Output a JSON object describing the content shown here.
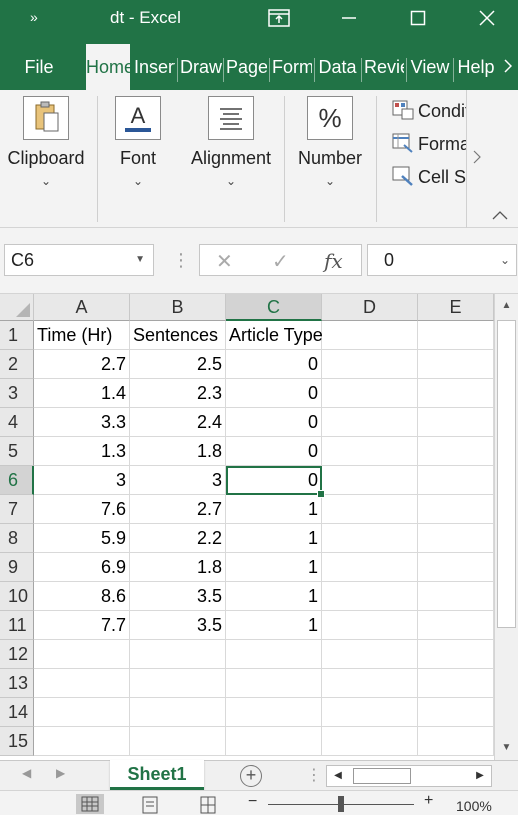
{
  "window": {
    "qat_label": "»",
    "title": "dt  -  Excel"
  },
  "tabs": [
    {
      "label": "File"
    },
    {
      "label": "Home"
    },
    {
      "label": "Insert"
    },
    {
      "label": "Draw"
    },
    {
      "label": "Page"
    },
    {
      "label": "Form"
    },
    {
      "label": "Data"
    },
    {
      "label": "Review"
    },
    {
      "label": "View"
    },
    {
      "label": "Help"
    }
  ],
  "ribbon": {
    "groups": [
      {
        "label": "Clipboard"
      },
      {
        "label": "Font"
      },
      {
        "label": "Alignment"
      },
      {
        "label": "Number"
      }
    ],
    "number_icon_glyph": "%",
    "styles": [
      {
        "label": "Conditional"
      },
      {
        "label": "Format"
      },
      {
        "label": "Cell Styles"
      }
    ]
  },
  "formula_bar": {
    "name_box": "C6",
    "fx": "fx",
    "value": "0"
  },
  "grid": {
    "columns": [
      "A",
      "B",
      "C",
      "D",
      "E"
    ],
    "selected_column": "C",
    "selected_row": 6,
    "row_numbers": [
      1,
      2,
      3,
      4,
      5,
      6,
      7,
      8,
      9,
      10,
      11,
      12,
      13,
      14,
      15
    ],
    "header_row": [
      "Time (Hr)",
      "Sentences",
      "Article Type"
    ],
    "rows": [
      [
        "2.7",
        "2.5",
        "0"
      ],
      [
        "1.4",
        "2.3",
        "0"
      ],
      [
        "3.3",
        "2.4",
        "0"
      ],
      [
        "1.3",
        "1.8",
        "0"
      ],
      [
        "3",
        "3",
        "0"
      ],
      [
        "7.6",
        "2.7",
        "1"
      ],
      [
        "5.9",
        "2.2",
        "1"
      ],
      [
        "6.9",
        "1.8",
        "1"
      ],
      [
        "8.6",
        "3.5",
        "1"
      ],
      [
        "7.7",
        "3.5",
        "1"
      ]
    ]
  },
  "sheets": [
    {
      "name": "Sheet1",
      "active": true
    }
  ],
  "status": {
    "zoom": "100%"
  },
  "colors": {
    "brand": "#217346",
    "ribbon_bg": "#f3f3f3",
    "header_bg": "#e8e8e8"
  }
}
